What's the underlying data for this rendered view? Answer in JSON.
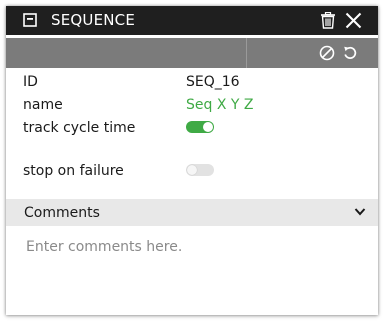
{
  "window": {
    "title": "SEQUENCE",
    "title_icon": "panel-icon",
    "actions": [
      "trash-icon",
      "close-icon"
    ]
  },
  "toolbar": {
    "actions": [
      "disable-icon",
      "reset-icon"
    ]
  },
  "properties": {
    "id": {
      "label": "ID",
      "value": "SEQ_16"
    },
    "name": {
      "label": "name",
      "value": "Seq X Y Z"
    },
    "track_cycle_time": {
      "label": "track cycle time",
      "enabled": true
    },
    "stop_on_failure": {
      "label": "stop on failure",
      "enabled": false
    }
  },
  "comments": {
    "header": "Comments",
    "placeholder": "Enter comments here.",
    "value": ""
  },
  "colors": {
    "titlebar": "#1f1f1f",
    "toolbar": "#7b7b7b",
    "accent_green": "#3faa45",
    "comments_header": "#e8e8e8"
  }
}
